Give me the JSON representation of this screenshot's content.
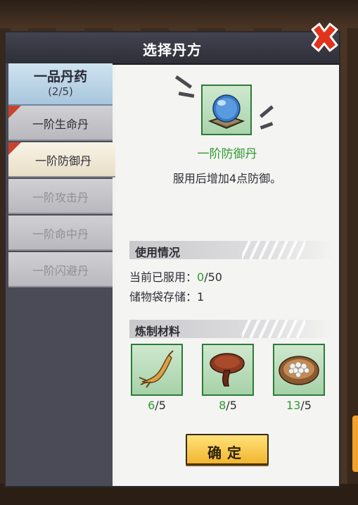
{
  "dialog": {
    "title": "选择丹方"
  },
  "tier": {
    "title": "一品丹药",
    "count": "(2/5)"
  },
  "tabs": [
    {
      "label": "一阶生命丹",
      "state": "normal",
      "badge": true
    },
    {
      "label": "一阶防御丹",
      "state": "selected",
      "badge": true
    },
    {
      "label": "一阶攻击丹",
      "state": "disabled",
      "badge": false
    },
    {
      "label": "一阶命中丹",
      "state": "disabled",
      "badge": false
    },
    {
      "label": "一阶闪避丹",
      "state": "disabled",
      "badge": false
    }
  ],
  "pill": {
    "name": "一阶防御丹",
    "description": "服用后增加4点防御。",
    "icon": "blue-orb-icon"
  },
  "usage": {
    "section_title": "使用情况",
    "consumed_label": "当前已服用：",
    "consumed_value": "0",
    "consumed_max": "/50",
    "storage_label": "储物袋存储：",
    "storage_value": "1"
  },
  "materials": {
    "section_title": "炼制材料",
    "items": [
      {
        "icon": "ginseng-icon",
        "have": "6",
        "need": "/5"
      },
      {
        "icon": "lingzhi-mushroom-icon",
        "have": "8",
        "need": "/5"
      },
      {
        "icon": "pearl-bowl-icon",
        "have": "13",
        "need": "/5"
      }
    ]
  },
  "confirm": {
    "label": "确定"
  },
  "colors": {
    "green": "#2f9a2f",
    "accent": "#f2a12a",
    "close_red": "#e2331c"
  }
}
